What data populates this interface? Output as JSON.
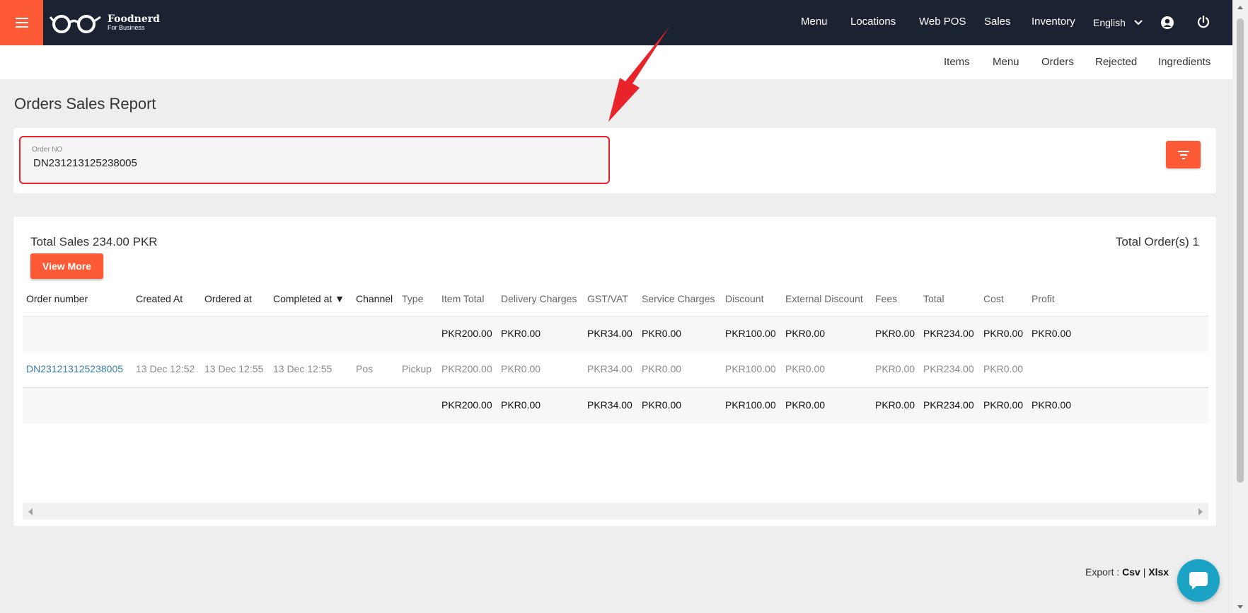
{
  "app": {
    "logo_name": "Foodnerd",
    "logo_sub": "For Business"
  },
  "topnav": {
    "items": [
      "Menu",
      "Locations",
      "Web POS",
      "Sales",
      "Inventory"
    ],
    "language": "English"
  },
  "subnav": {
    "items": [
      "Items",
      "Menu",
      "Orders",
      "Rejected",
      "Ingredients"
    ]
  },
  "page": {
    "title": "Orders Sales Report"
  },
  "filter": {
    "order_no_label": "Order NO",
    "order_no_value": "DN231213125238005"
  },
  "summary": {
    "total_sales": "Total Sales 234.00 PKR",
    "total_orders": "Total Order(s) 1",
    "view_more": "View More"
  },
  "table": {
    "columns": [
      "Order number",
      "Created At",
      "Ordered at",
      "Completed at ▼",
      "Channel",
      "Type",
      "Item Total",
      "Delivery Charges",
      "GST/VAT",
      "Service Charges",
      "Discount",
      "External Discount",
      "Fees",
      "Total",
      "Cost",
      "Profit"
    ],
    "top_total": [
      "",
      "",
      "",
      "",
      "",
      "",
      "PKR200.00",
      "PKR0.00",
      "PKR34.00",
      "PKR0.00",
      "PKR100.00",
      "PKR0.00",
      "PKR0.00",
      "PKR234.00",
      "PKR0.00",
      "PKR0.00"
    ],
    "rows": [
      [
        "DN231213125238005",
        "13 Dec 12:52",
        "13 Dec 12:55",
        "13 Dec 12:55",
        "Pos",
        "Pickup",
        "PKR200.00",
        "PKR0.00",
        "PKR34.00",
        "PKR0.00",
        "PKR100.00",
        "PKR0.00",
        "PKR0.00",
        "PKR234.00",
        "PKR0.00",
        ""
      ]
    ],
    "bottom_total": [
      "",
      "",
      "",
      "",
      "",
      "",
      "PKR200.00",
      "PKR0.00",
      "PKR34.00",
      "PKR0.00",
      "PKR100.00",
      "PKR0.00",
      "PKR0.00",
      "PKR234.00",
      "PKR0.00",
      "PKR0.00"
    ]
  },
  "export": {
    "label": "Export",
    "sep1": ":",
    "csv": "Csv",
    "sep2": "|",
    "xlsx": "Xlsx"
  },
  "colors": {
    "accent": "#ff5a36",
    "navbar": "#1b2232",
    "highlight_border": "#e8232a",
    "annotation_arrow": "#e8232a",
    "chat": "#1aa3c4",
    "link": "#3a7fa8"
  },
  "icons": [
    "hamburger-icon",
    "glasses-logo-icon",
    "chevron-down-icon",
    "user-circle-icon",
    "power-icon",
    "filter-icon",
    "chat-icon",
    "annotation-arrow"
  ]
}
